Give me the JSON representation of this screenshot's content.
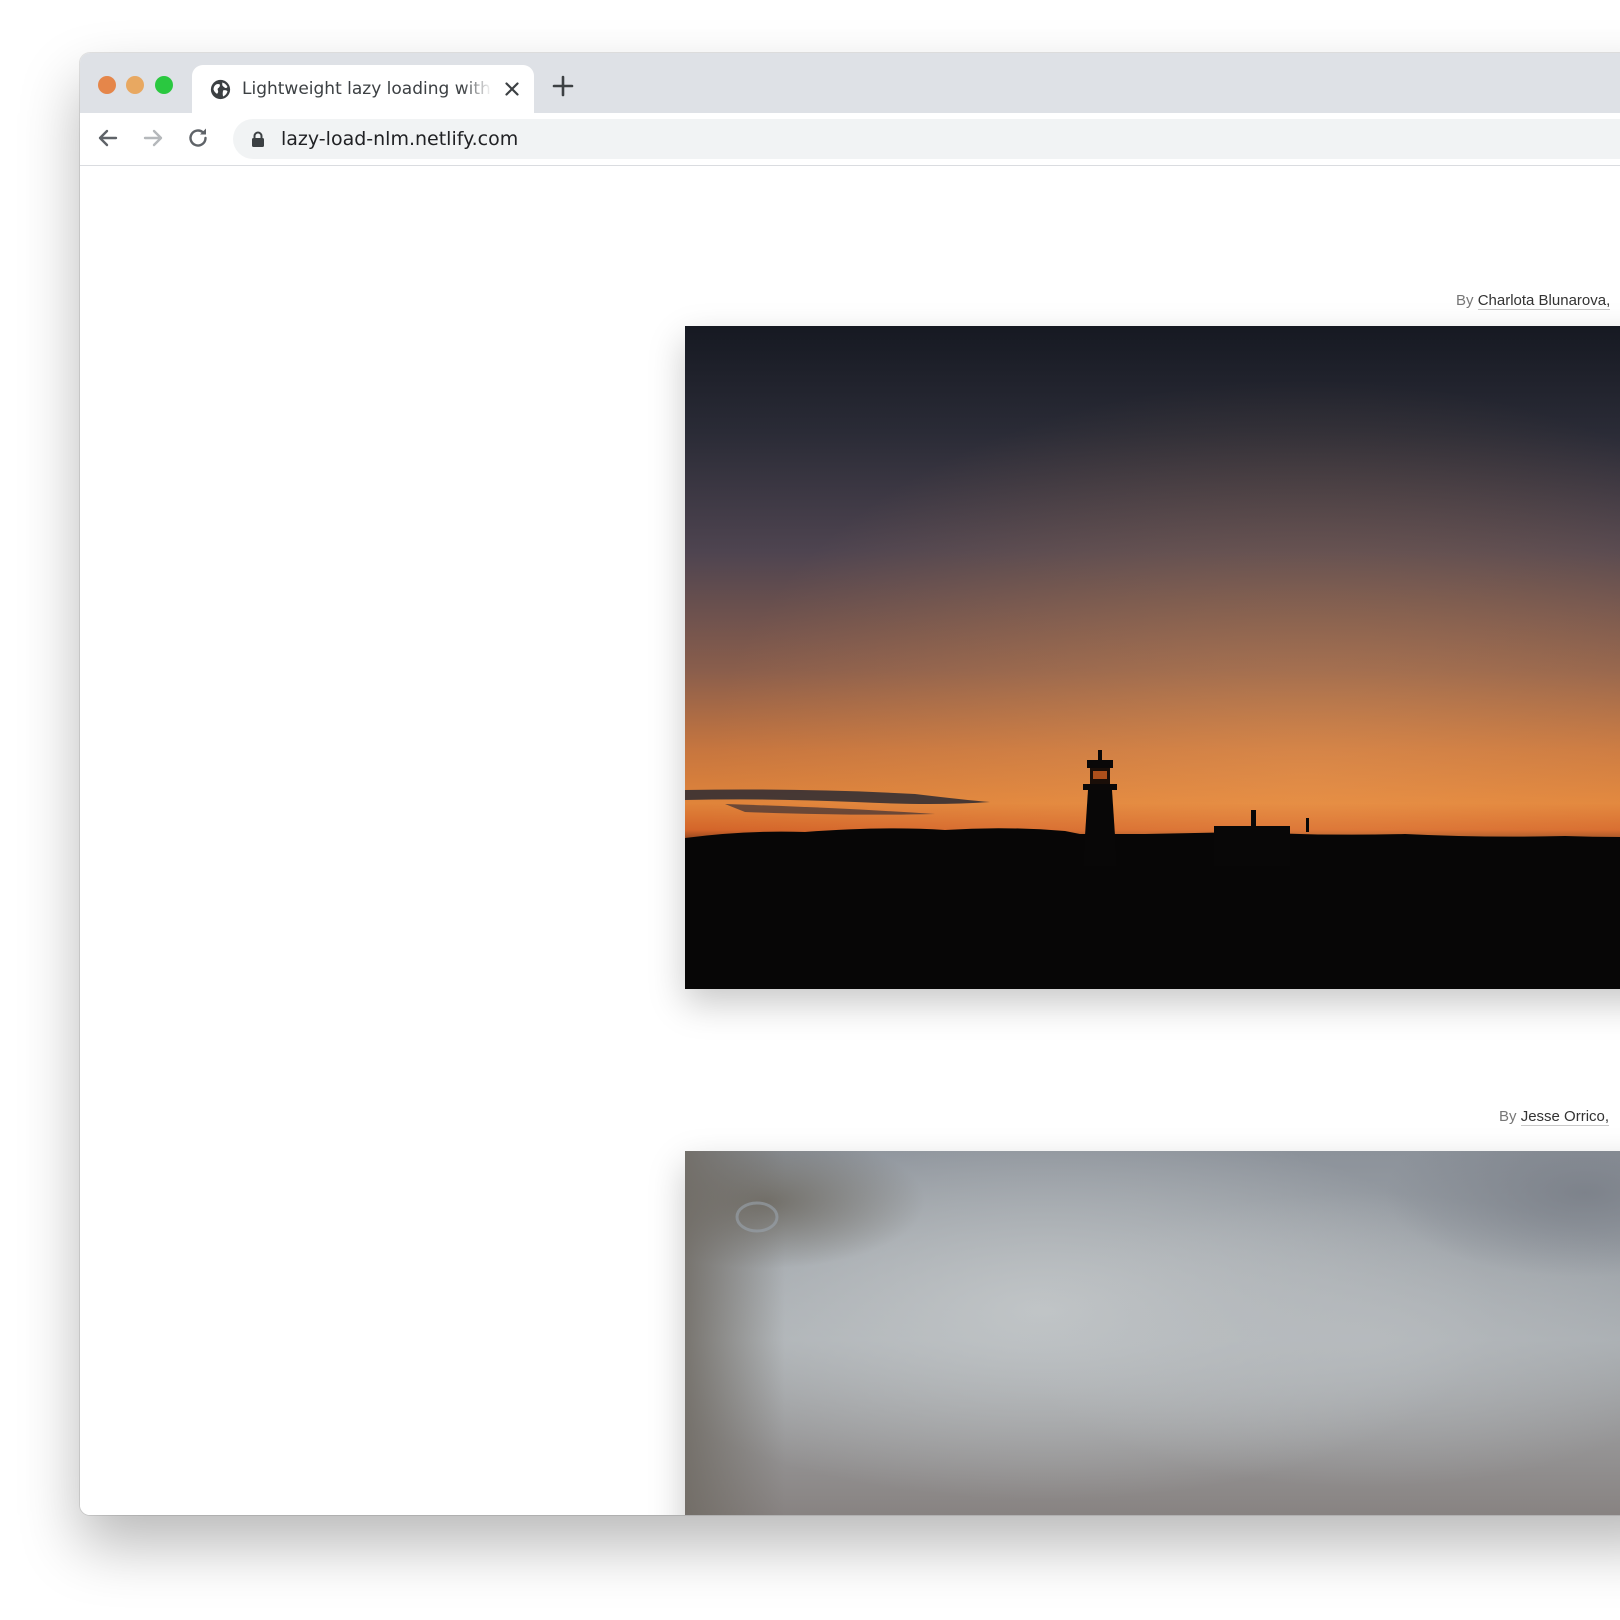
{
  "browser": {
    "tab": {
      "title": "Lightweight lazy loading with NLM"
    },
    "address_bar": {
      "url": "lazy-load-nlm.netlify.com"
    }
  },
  "page": {
    "photos": [
      {
        "credit_prefix": "By",
        "credit_name": "Charlota Blunarova,",
        "loaded": true
      },
      {
        "credit_prefix": "By",
        "credit_name": "Jesse Orrico,",
        "loaded": false
      }
    ]
  },
  "colors": {
    "tabstrip": "#dee1e6",
    "close_dot": "#e5864a",
    "minimize_dot": "#e8a861",
    "zoom_dot": "#2ac840",
    "omnibox": "#f1f3f4"
  },
  "icons": {
    "tab_favicon": "globe-icon",
    "tab_close": "close-icon",
    "new_tab": "plus-icon",
    "back": "arrow-left-icon",
    "forward": "arrow-right-icon",
    "reload": "reload-icon",
    "secure": "lock-icon"
  }
}
